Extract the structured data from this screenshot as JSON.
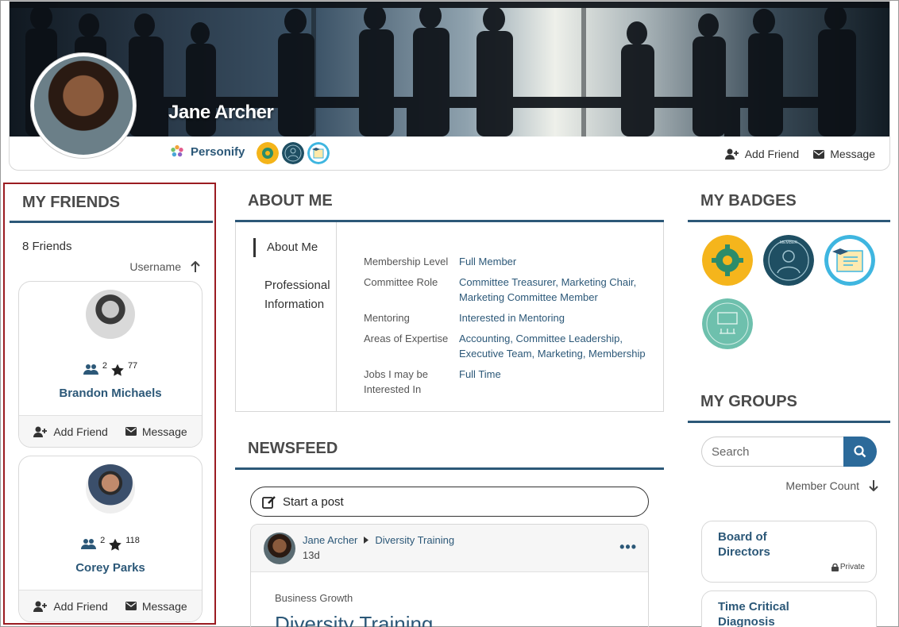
{
  "profile": {
    "name": "Jane Archer",
    "org_name": "Personify",
    "actions": {
      "add_friend": "Add Friend",
      "message": "Message"
    }
  },
  "friends": {
    "title": "MY FRIENDS",
    "count_label": "8 Friends",
    "sort_label": "Username",
    "items": [
      {
        "name": "Brandon Michaels",
        "friends": "2",
        "points": "77",
        "add_friend": "Add Friend",
        "message": "Message"
      },
      {
        "name": "Corey Parks",
        "friends": "2",
        "points": "118",
        "add_friend": "Add Friend",
        "message": "Message"
      }
    ]
  },
  "about": {
    "title": "ABOUT ME",
    "tabs": [
      "About Me",
      "Professional",
      "Information"
    ],
    "rows": [
      {
        "key": "Membership Level",
        "value": "Full Member"
      },
      {
        "key": "Committee Role",
        "value": "Committee Treasurer, Marketing Chair, Marketing Committee Member"
      },
      {
        "key": "Mentoring",
        "value": "Interested in Mentoring"
      },
      {
        "key": "Areas of Expertise",
        "value": "Accounting, Committee Leadership, Executive Team, Marketing, Membership"
      },
      {
        "key": "Jobs I may be Interested In",
        "value": "Full Time"
      }
    ]
  },
  "newsfeed": {
    "title": "NEWSFEED",
    "start_post": "Start a post",
    "post": {
      "author": "Jane Archer",
      "group": "Diversity Training",
      "time": "13d",
      "more": "•••",
      "category": "Business Growth",
      "heading": "Diversity Training"
    }
  },
  "badges": {
    "title": "MY BADGES",
    "items": [
      "settings-badge",
      "member-badge",
      "certificate-badge",
      "annual-meeting-attendee-badge"
    ]
  },
  "groups": {
    "title": "MY GROUPS",
    "search_placeholder": "Search",
    "sort_label": "Member Count",
    "items": [
      {
        "name": "Board of Directors",
        "privacy": "Private"
      },
      {
        "name": "Time Critical Diagnosis",
        "privacy": ""
      }
    ]
  },
  "colors": {
    "accent": "#2c5878",
    "rule": "#2c5878",
    "highlight_border": "#9b1c22",
    "search_button": "#2c6a9a"
  }
}
